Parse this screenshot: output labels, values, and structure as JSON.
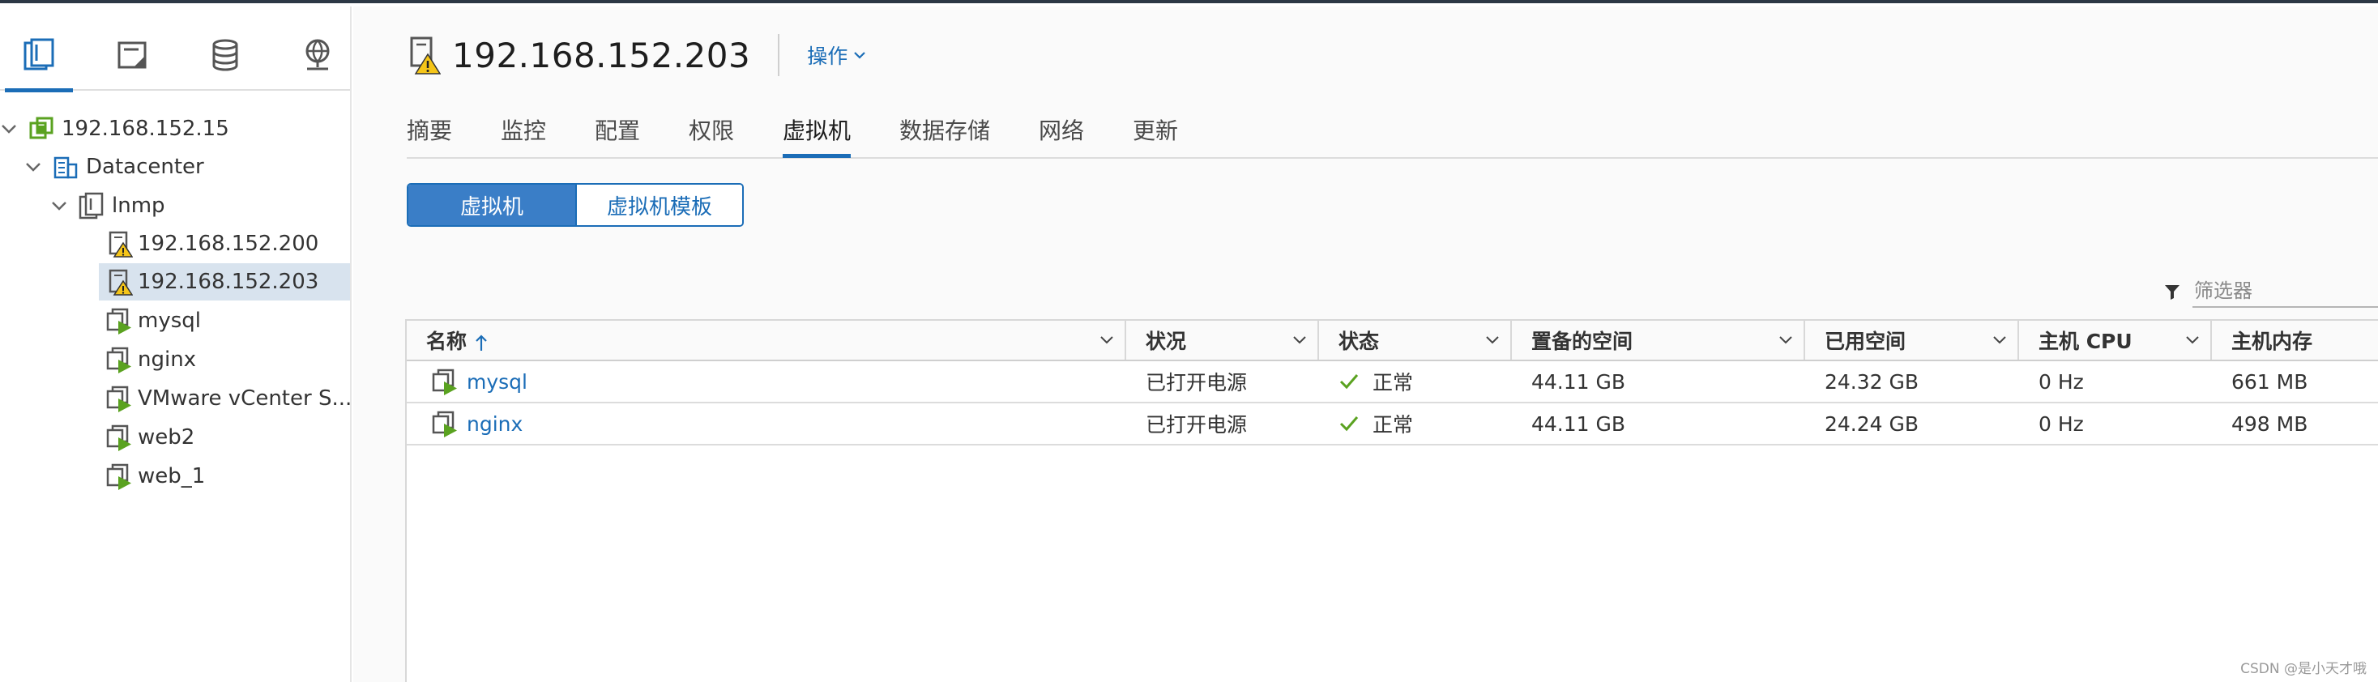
{
  "colors": {
    "accent": "#1b6db7",
    "selected_row": "#d8e3ee",
    "ok_green": "#5aa220",
    "warning_yellow": "#f5c518",
    "top_bar": "#2c3845"
  },
  "navigator": {
    "tabs": [
      {
        "icon": "hosts-and-clusters-icon",
        "active": true
      },
      {
        "icon": "vms-and-templates-icon",
        "active": false
      },
      {
        "icon": "storage-icon",
        "active": false
      },
      {
        "icon": "networking-icon",
        "active": false
      }
    ],
    "tree": [
      {
        "label": "192.168.152.15",
        "icon": "vcenter-icon",
        "expanded": true
      },
      {
        "label": "Datacenter",
        "icon": "datacenter-icon",
        "expanded": true
      },
      {
        "label": "lnmp",
        "icon": "cluster-icon",
        "expanded": true
      },
      {
        "label": "192.168.152.200",
        "icon": "host-warning-icon"
      },
      {
        "label": "192.168.152.203",
        "icon": "host-warning-icon",
        "selected": true
      },
      {
        "label": "mysql",
        "icon": "vm-powered-on-icon"
      },
      {
        "label": "nginx",
        "icon": "vm-powered-on-icon"
      },
      {
        "label": "VMware vCenter S...",
        "icon": "vm-powered-on-icon"
      },
      {
        "label": "web2",
        "icon": "vm-powered-on-icon"
      },
      {
        "label": "web_1",
        "icon": "vm-powered-on-icon"
      }
    ]
  },
  "header": {
    "title": "192.168.152.203",
    "actions_label": "操作"
  },
  "tabs": [
    {
      "label": "摘要"
    },
    {
      "label": "监控"
    },
    {
      "label": "配置"
    },
    {
      "label": "权限"
    },
    {
      "label": "虚拟机",
      "active": true
    },
    {
      "label": "数据存储"
    },
    {
      "label": "网络"
    },
    {
      "label": "更新"
    }
  ],
  "segmented": {
    "vms": "虚拟机",
    "templates": "虚拟机模板"
  },
  "filter": {
    "placeholder": "筛选器"
  },
  "grid": {
    "columns": [
      "名称",
      "状况",
      "状态",
      "置备的空间",
      "已用空间",
      "主机 CPU",
      "主机内存"
    ],
    "sort_column": "名称",
    "sort_direction": "ascending",
    "rows": [
      {
        "name": "mysql",
        "state": "已打开电源",
        "status": "正常",
        "provisioned": "44.11 GB",
        "used": "24.32 GB",
        "cpu": "0 Hz",
        "memory": "661 MB"
      },
      {
        "name": "nginx",
        "state": "已打开电源",
        "status": "正常",
        "provisioned": "44.11 GB",
        "used": "24.24 GB",
        "cpu": "0 Hz",
        "memory": "498 MB"
      }
    ]
  },
  "watermark": "CSDN @是小天才哦"
}
